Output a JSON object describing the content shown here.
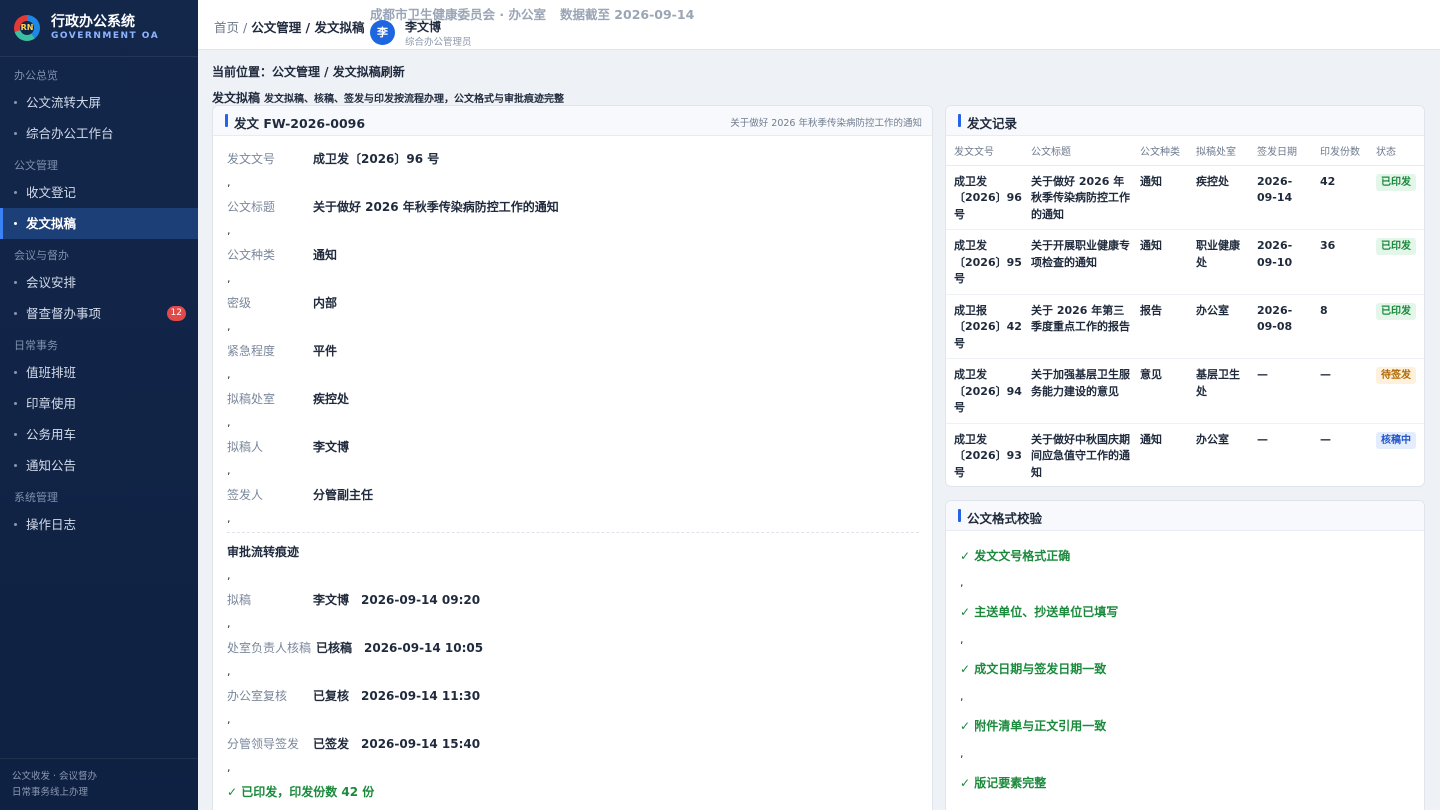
{
  "brand": {
    "logo_text": "RN",
    "name": "行政办公系统",
    "sub": "GOVERNMENT OA"
  },
  "nav": {
    "groups": [
      {
        "label": "办公总览",
        "items": [
          {
            "label": "公文流转大屏"
          },
          {
            "label": "综合办公工作台"
          }
        ]
      },
      {
        "label": "公文管理",
        "items": [
          {
            "label": "收文登记"
          },
          {
            "label": "发文拟稿"
          }
        ]
      },
      {
        "label": "会议与督办",
        "items": [
          {
            "label": "会议安排"
          },
          {
            "label": "督查督办事项",
            "badge": "12"
          }
        ]
      },
      {
        "label": "日常事务",
        "items": [
          {
            "label": "值班排班"
          },
          {
            "label": "印章使用"
          },
          {
            "label": "公务用车"
          },
          {
            "label": "通知公告"
          }
        ]
      },
      {
        "label": "系统管理",
        "items": [
          {
            "label": "操作日志"
          }
        ]
      }
    ],
    "footer": [
      "公文收发 · 会议督办",
      "日常事务线上办理"
    ]
  },
  "header": {
    "crumb_home": "首页",
    "crumb_sep": " / ",
    "crumb_path": "公文管理 / 发文拟稿",
    "org": "成都市卫生健康委员会 · 办公室",
    "data_date": "数据截至 2026-09-14",
    "avatar": "李",
    "user_name": "李文博",
    "user_role": "综合办公管理员"
  },
  "page": {
    "location": "当前位置：公文管理 / 发文拟稿刷新",
    "title": "发文拟稿",
    "subtitle": "发文拟稿、核稿、签发与印发按流程办理，公文格式与审批痕迹完整"
  },
  "doc_panel": {
    "title": "发文 FW-2026-0096",
    "subject": "关于做好 2026 年秋季传染病防控工作的通知",
    "comma": ",",
    "fields": [
      {
        "k": "发文文号",
        "v": "成卫发〔2026〕96 号"
      },
      {
        "k": "公文标题",
        "v": "关于做好 2026 年秋季传染病防控工作的通知"
      },
      {
        "k": "公文种类",
        "v": "通知"
      },
      {
        "k": "密级",
        "v": "内部"
      },
      {
        "k": "紧急程度",
        "v": "平件"
      },
      {
        "k": "拟稿处室",
        "v": "疾控处"
      },
      {
        "k": "拟稿人",
        "v": "李文博"
      },
      {
        "k": "签发人",
        "v": "分管副主任"
      }
    ],
    "approval_title": "审批流转痕迹",
    "approvals": [
      {
        "k": "拟稿",
        "v": "李文博　2026-09-14 09:20"
      },
      {
        "k": "处室负责人核稿",
        "v": "已核稿　2026-09-14 10:05"
      },
      {
        "k": "办公室复核",
        "v": "已复核　2026-09-14 11:30"
      },
      {
        "k": "分管领导签发",
        "v": "已签发　2026-09-14 15:40"
      }
    ],
    "result": "✓ 已印发，印发份数 42 份"
  },
  "records": {
    "title": "发文记录",
    "columns": [
      "发文文号",
      "公文标题",
      "公文种类",
      "拟稿处室",
      "签发日期",
      "印发份数",
      "状态"
    ],
    "rows": [
      {
        "no": "成卫发〔2026〕96 号",
        "title": "关于做好 2026 年秋季传染病防控工作的通知",
        "type": "通知",
        "dept": "疾控处",
        "date": "2026-09-14",
        "copies": "42",
        "status": "已印发",
        "tone": "g"
      },
      {
        "no": "成卫发〔2026〕95 号",
        "title": "关于开展职业健康专项检查的通知",
        "type": "通知",
        "dept": "职业健康处",
        "date": "2026-09-10",
        "copies": "36",
        "status": "已印发",
        "tone": "g"
      },
      {
        "no": "成卫报〔2026〕42 号",
        "title": "关于 2026 年第三季度重点工作的报告",
        "type": "报告",
        "dept": "办公室",
        "date": "2026-09-08",
        "copies": "8",
        "status": "已印发",
        "tone": "g"
      },
      {
        "no": "成卫发〔2026〕94 号",
        "title": "关于加强基层卫生服务能力建设的意见",
        "type": "意见",
        "dept": "基层卫生处",
        "date": "—",
        "copies": "—",
        "status": "待签发",
        "tone": "o"
      },
      {
        "no": "成卫发〔2026〕93 号",
        "title": "关于做好中秋国庆期间应急值守工作的通知",
        "type": "通知",
        "dept": "办公室",
        "date": "—",
        "copies": "—",
        "status": "核稿中",
        "tone": "b"
      }
    ]
  },
  "check": {
    "title": "公文格式校验",
    "comma": ",",
    "items": [
      "✓ 发文文号格式正确",
      "✓ 主送单位、抄送单位已填写",
      "✓ 成文日期与签发日期一致",
      "✓ 附件清单与正文引用一致",
      "✓ 版记要素完整"
    ]
  },
  "colors": {
    "sidebar": "#13274b",
    "accent": "#2563eb",
    "success": "#1b8a3d",
    "warning": "#b26a00",
    "badge": "#e24a4a"
  }
}
